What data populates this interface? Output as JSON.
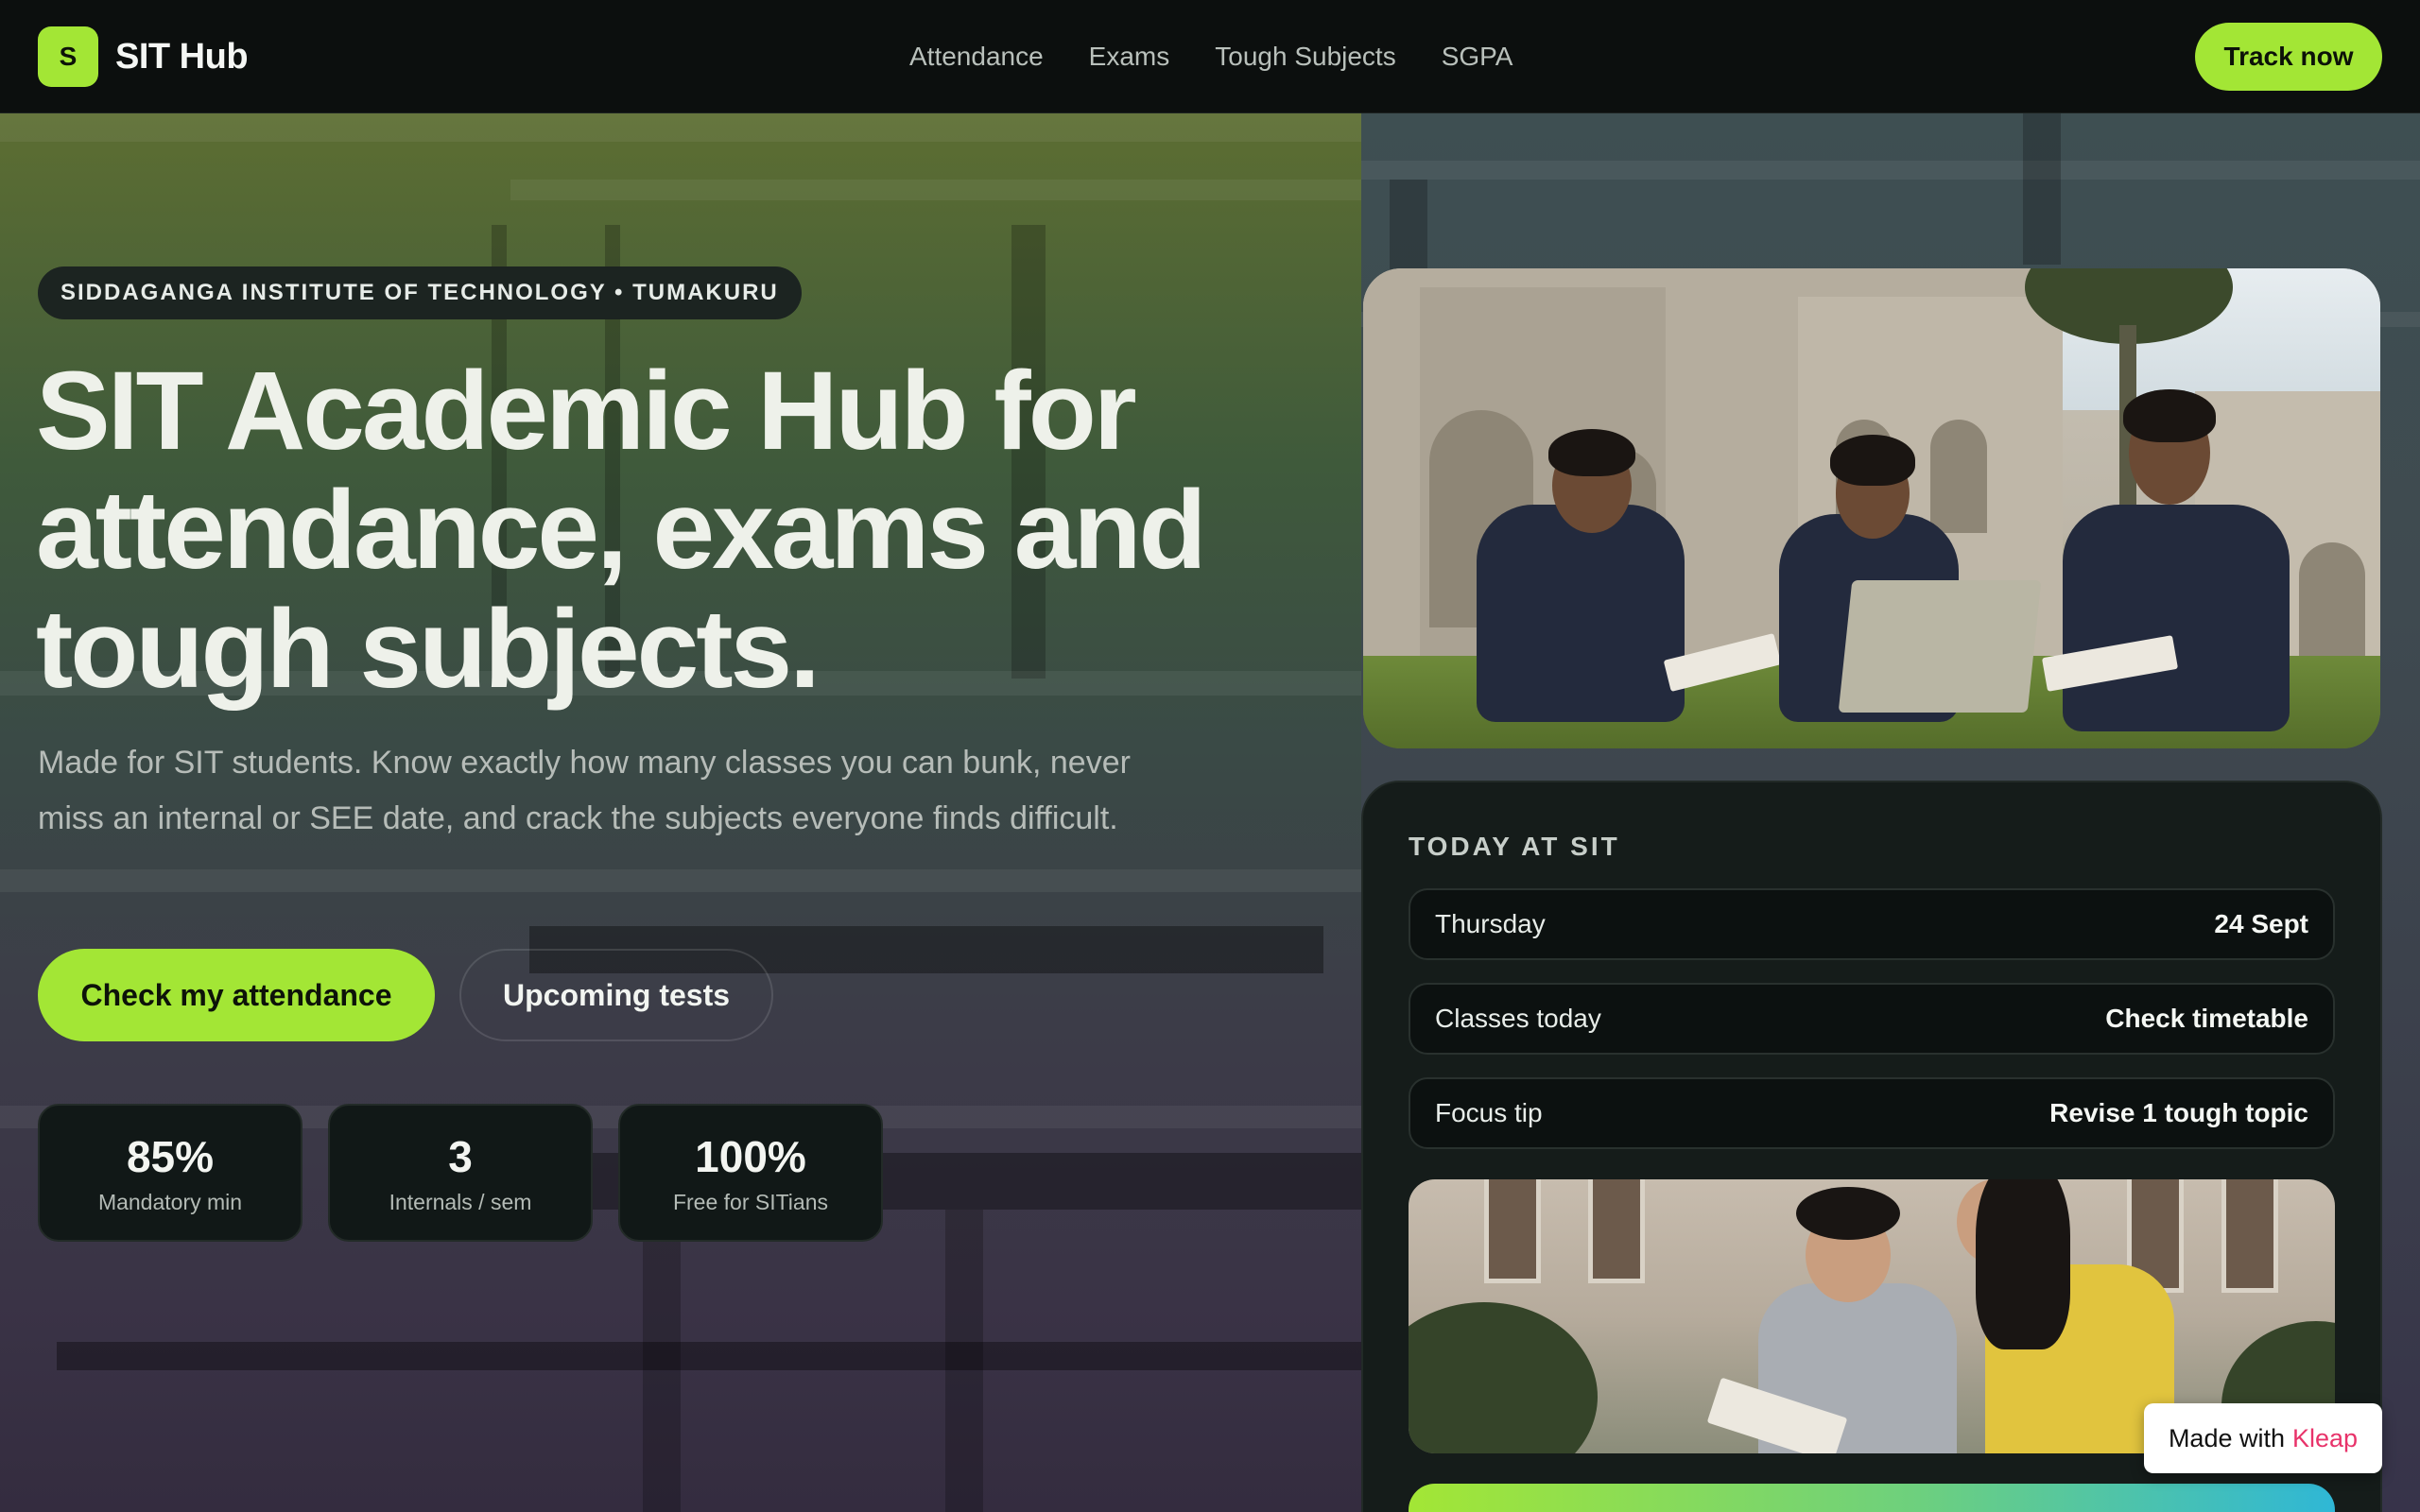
{
  "nav": {
    "logo_mark": "S",
    "brand": "SIT Hub",
    "links": [
      "Attendance",
      "Exams",
      "Tough Subjects",
      "SGPA"
    ],
    "cta": "Track now"
  },
  "hero": {
    "eyebrow": "SIDDAGANGA INSTITUTE OF TECHNOLOGY • TUMAKURU",
    "headline": "SIT Academic Hub for attendance, exams and tough subjects.",
    "subtext": "Made for SIT students. Know exactly how many classes you can bunk, never miss an internal or SEE date, and crack the subjects everyone finds difficult.",
    "primary_button": "Check my attendance",
    "secondary_button": "Upcoming tests",
    "stats": [
      {
        "value": "85%",
        "label": "Mandatory min"
      },
      {
        "value": "3",
        "label": "Internals / sem"
      },
      {
        "value": "100%",
        "label": "Free for SITians"
      }
    ]
  },
  "today": {
    "title": "TODAY AT SIT",
    "rows": [
      {
        "label": "Thursday",
        "value": "24 Sept"
      },
      {
        "label": "Classes today",
        "value": "Check timetable"
      },
      {
        "label": "Focus tip",
        "value": "Revise 1 tough topic"
      }
    ]
  },
  "badge": {
    "prefix": "Made with",
    "brand": "Kleap"
  },
  "colors": {
    "accent": "#a3e635",
    "background": "#0c0f0e",
    "card": "#151c1a",
    "badge_brand": "#e8336a"
  },
  "icons": {
    "photo_top": "students-studying-campus-image",
    "photo_bottom": "students-reading-image"
  }
}
